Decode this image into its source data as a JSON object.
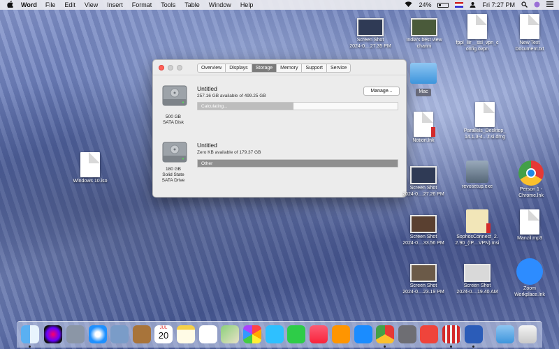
{
  "menubar": {
    "apple": "",
    "app": "Word",
    "items": [
      "File",
      "Edit",
      "View",
      "Insert",
      "Format",
      "Tools",
      "Table",
      "Window",
      "Help"
    ],
    "battery": "24%",
    "clock": "Fri 7:27 PM"
  },
  "window": {
    "tabs": [
      "Overview",
      "Displays",
      "Storage",
      "Memory",
      "Support",
      "Service"
    ],
    "active_tab": "Storage",
    "drives": [
      {
        "name": "Untitled",
        "info": "257.16 GB available of 499.25 GB",
        "caption1": "500 GB",
        "caption2": "SATA Disk",
        "caption3": "",
        "bar_label": "Calculating...",
        "bar_fill": 0.48
      },
      {
        "name": "Untitled",
        "info": "Zero KB available of 179.37 GB",
        "caption1": "180 GB",
        "caption2": "Solid State",
        "caption3": "SATA Drive",
        "bar_label": "Other",
        "bar_fill": 1.0
      }
    ],
    "manage_button": "Manage..."
  },
  "desktop_icons": [
    {
      "l1": "Screen Shot",
      "l2": "2024-0....27.35 PM"
    },
    {
      "l1": "India's best view",
      "l2": "channi"
    },
    {
      "l1": "fppl_liir__ssl_vpn_c",
      "l2": "onfig.ovpn"
    },
    {
      "l1": "New Text",
      "l2": "Document.txt"
    },
    {
      "l1": "Mac",
      "l2": ""
    },
    {
      "l1": "Notion.lnk",
      "l2": ""
    },
    {
      "l1": "Parallels_Desktop_",
      "l2": "14.1.3-4....t.si.dmg"
    },
    {
      "l1": "Windows 10.iso",
      "l2": ""
    },
    {
      "l1": "Screen Shot",
      "l2": "2024-0....27.26 PM"
    },
    {
      "l1": "revosetup.exe",
      "l2": ""
    },
    {
      "l1": "Person 1 -",
      "l2": "Chrome.lnk"
    },
    {
      "l1": "Screen Shot",
      "l2": "2024-0....33.56 PM"
    },
    {
      "l1": "SophosConnect_2.",
      "l2": "2.90_(IP....VPN).msi"
    },
    {
      "l1": "Manzil.mp3",
      "l2": ""
    },
    {
      "l1": "Screen Shot",
      "l2": "2024-0....23.19 PM"
    },
    {
      "l1": "Screen Shot",
      "l2": "2024-0....19.40 AM"
    },
    {
      "l1": "Zoom",
      "l2": "Workplace.lnk"
    }
  ],
  "calendar": {
    "month": "JUL",
    "day": "20"
  },
  "dock_icons": [
    "finder-icon",
    "siri-icon",
    "launchpad-icon",
    "safari-icon",
    "preview-icon",
    "notefile-icon",
    "calendar-icon",
    "notes-icon",
    "reminders-icon",
    "maps-icon",
    "photos-icon",
    "messages-icon",
    "facetime-icon",
    "music-icon",
    "books-icon",
    "app-store-icon",
    "chrome-icon",
    "system-preferences-icon",
    "anydesk-icon",
    "parallels-icon",
    "word-icon",
    "downloads-folder-icon",
    "trash-icon"
  ],
  "colors": {
    "active_tab": "#7b7b7b",
    "close_light": "#ff5f57"
  }
}
